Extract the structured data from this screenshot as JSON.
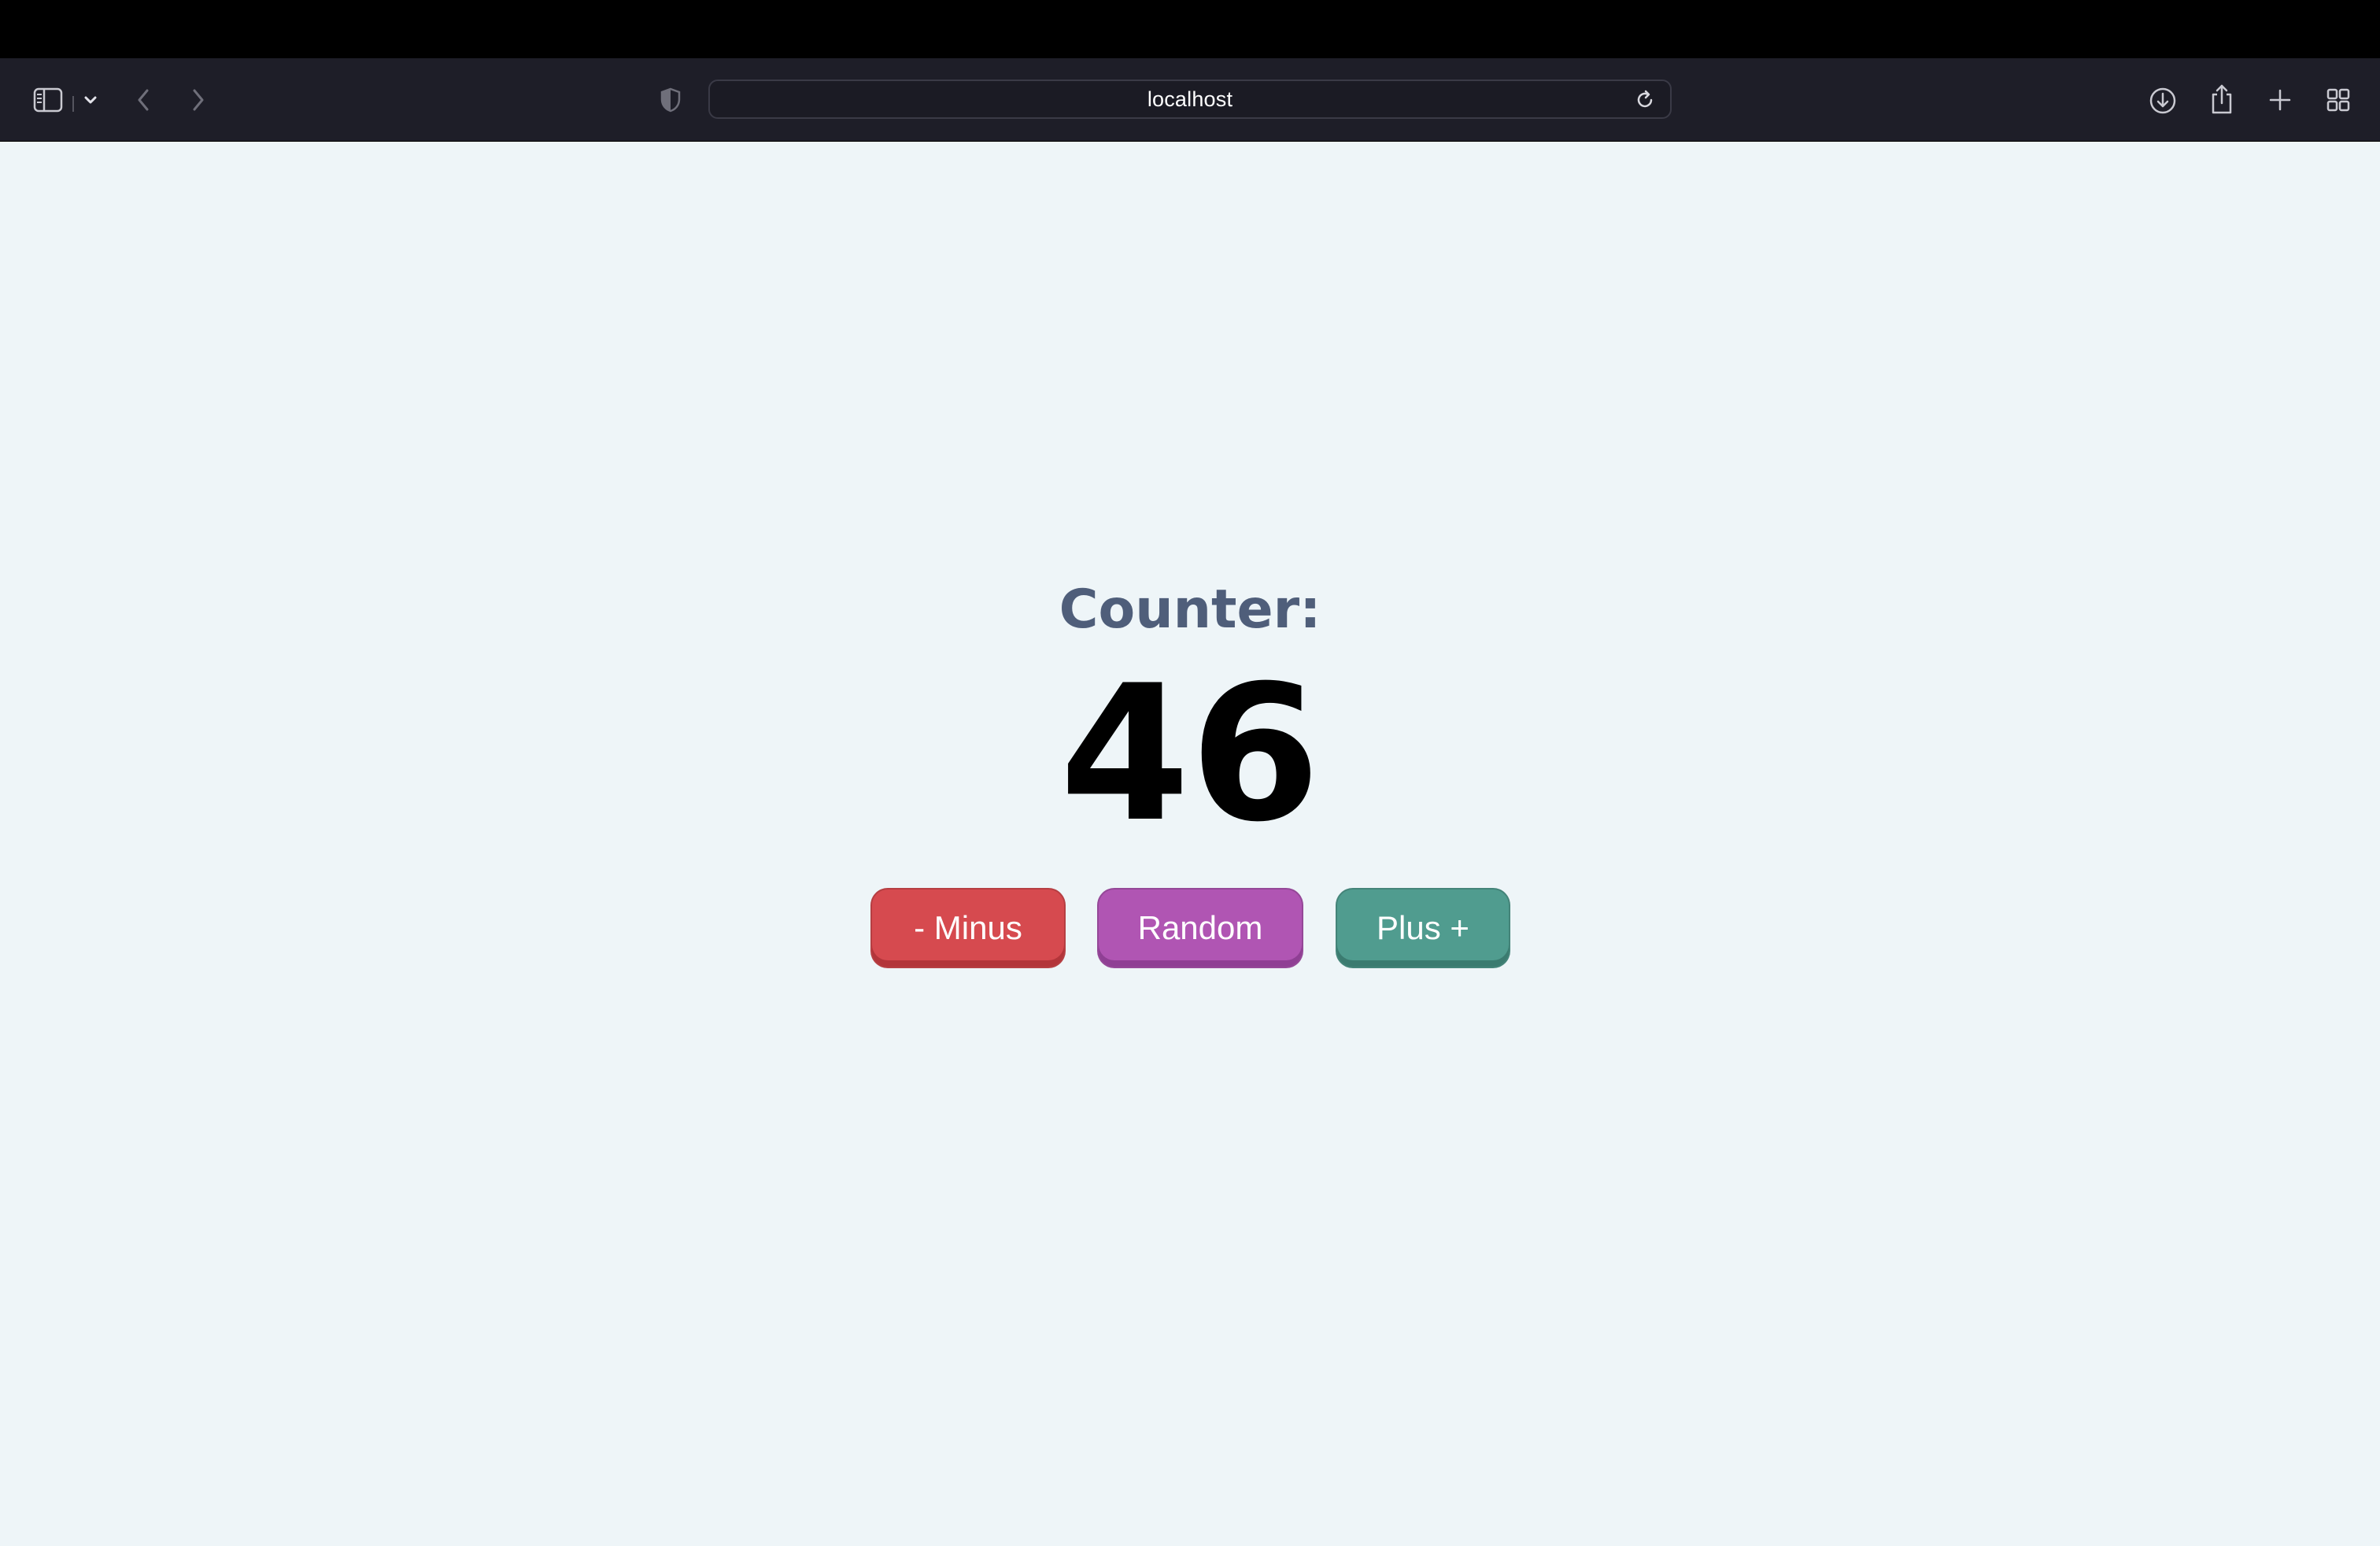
{
  "browser": {
    "url": "localhost",
    "icons": {
      "sidebar": "sidebar-icon",
      "sidebar_menu": "chevron-down-icon",
      "back": "back-icon",
      "forward": "forward-icon",
      "privacy": "shield-icon",
      "reload": "reload-icon",
      "downloads": "download-icon",
      "share": "share-icon",
      "new_tab": "plus-icon",
      "tab_overview": "grid-icon"
    }
  },
  "page": {
    "label": "Counter:",
    "value": "46",
    "buttons": {
      "minus": "- Minus",
      "random": "Random",
      "plus": "Plus +"
    },
    "colors": {
      "background": "#eef5f8",
      "label": "#4f5e7a",
      "minus": "#d64a4f",
      "random": "#b055b3",
      "plus": "#509c8f"
    }
  }
}
